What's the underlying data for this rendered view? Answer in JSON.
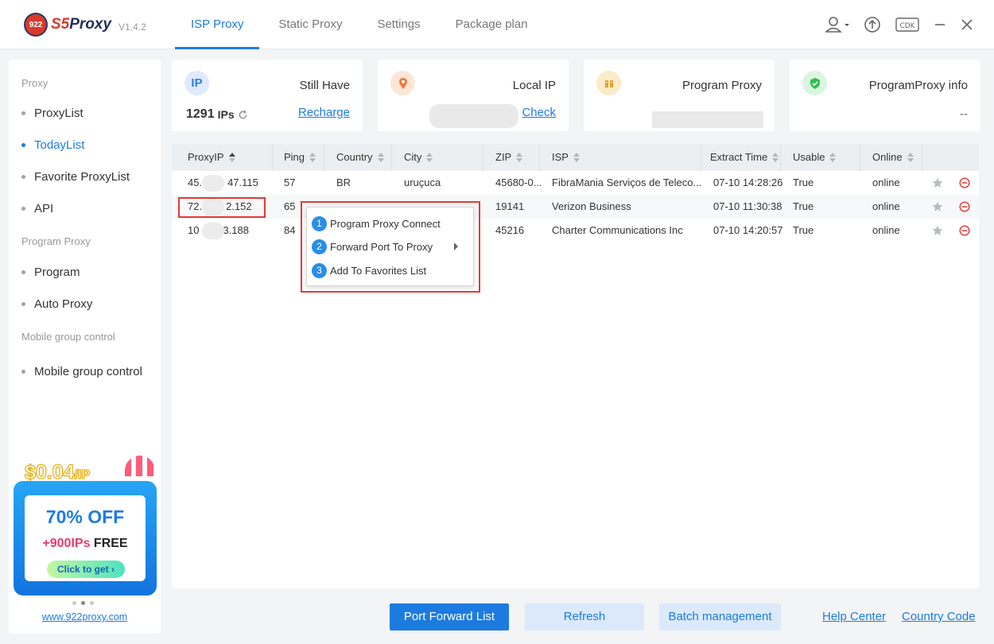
{
  "app": {
    "logo_badge": "922",
    "logo_s5": "S5",
    "logo_proxy": "Proxy",
    "version": "V1.4.2"
  },
  "nav": {
    "tabs": [
      "ISP Proxy",
      "Static Proxy",
      "Settings",
      "Package plan"
    ],
    "active": 0
  },
  "window": {
    "cdk_label": "CDK"
  },
  "sidebar": {
    "sections": [
      {
        "heading": "Proxy",
        "items": [
          "ProxyList",
          "TodayList",
          "Favorite ProxyList",
          "API"
        ]
      },
      {
        "heading": "Program Proxy",
        "items": [
          "Program",
          "Auto Proxy"
        ]
      },
      {
        "heading": "Mobile group control",
        "items": [
          "Mobile group control"
        ]
      }
    ],
    "active_item": "TodayList",
    "promo": {
      "price": "$0.04",
      "price_unit": "/IP",
      "discount": "70% OFF",
      "plus": "+",
      "bonus": "900IPs",
      "free": "FREE",
      "button": "Click to get ›"
    },
    "site_link": "www.922proxy.com"
  },
  "cards": {
    "still_have": {
      "icon_label": "IP",
      "title": "Still Have",
      "value": "1291",
      "unit": "IPs",
      "link": "Recharge"
    },
    "local_ip": {
      "title": "Local IP",
      "link": "Check"
    },
    "program_proxy": {
      "title": "Program Proxy"
    },
    "program_proxy_info": {
      "title": "ProgramProxy info",
      "value": "--"
    }
  },
  "table": {
    "columns": [
      "ProxyIP",
      "Ping",
      "Country",
      "City",
      "ZIP",
      "ISP",
      "Extract Time",
      "Usable",
      "Online"
    ],
    "rows": [
      {
        "ip_start": "45.",
        "ip_end": "47.115",
        "ping": "57",
        "country": "BR",
        "city": "uruçuca",
        "zip": "45680-0...",
        "isp": "FibraMania Serviços de Teleco...",
        "time": "07-10 14:28:26",
        "usable": "True",
        "online": "online"
      },
      {
        "ip_start": "72.",
        "ip_end": "2.152",
        "ping": "65",
        "country": "",
        "city": "",
        "zip": "19141",
        "isp": "Verizon Business",
        "time": "07-10 11:30:38",
        "usable": "True",
        "online": "online"
      },
      {
        "ip_start": "10",
        "ip_end": "3.188",
        "ping": "84",
        "country": "",
        "city": "",
        "zip": "45216",
        "isp": "Charter Communications Inc",
        "time": "07-10 14:20:57",
        "usable": "True",
        "online": "online"
      }
    ]
  },
  "context_menu": {
    "items": [
      {
        "num": "1",
        "label": "Program Proxy Connect"
      },
      {
        "num": "2",
        "label": "Forward Port To Proxy"
      },
      {
        "num": "3",
        "label": "Add To Favorites List"
      }
    ]
  },
  "bottom": {
    "port_forward": "Port Forward List",
    "refresh": "Refresh",
    "batch": "Batch management",
    "help": "Help Center",
    "country_code": "Country Code"
  },
  "colors": {
    "accent": "#1d7bdf",
    "highlight": "#e53935",
    "delete": "#e53935"
  }
}
